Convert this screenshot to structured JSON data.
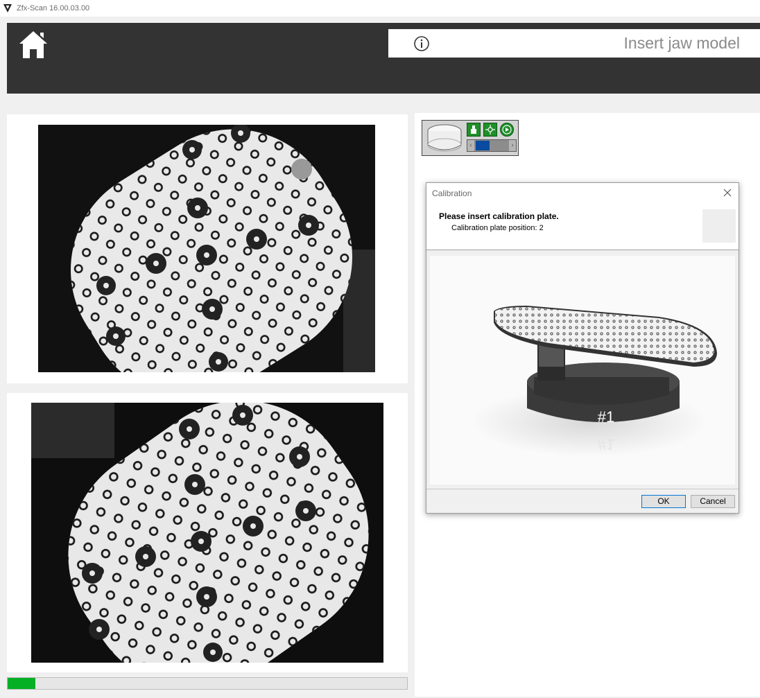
{
  "app": {
    "title": "Zfx-Scan 16.00.03.00"
  },
  "header": {
    "step_title": "Insert jaw model"
  },
  "progress": {
    "percent": 7
  },
  "dialog": {
    "title": "Calibration",
    "heading": "Please insert calibration plate.",
    "subtext": "Calibration plate position: 2",
    "plate_label": "#1",
    "ok_label": "OK",
    "cancel_label": "Cancel"
  },
  "colors": {
    "header_bg": "#333333",
    "progress_fill": "#06b025",
    "device_button": "#1f8f2a",
    "slider_thumb": "#0a4aa0"
  },
  "icons": [
    "app-logo-icon",
    "home-icon",
    "info-icon",
    "close-icon",
    "camera-icon",
    "crosshair-icon",
    "play-icon"
  ]
}
